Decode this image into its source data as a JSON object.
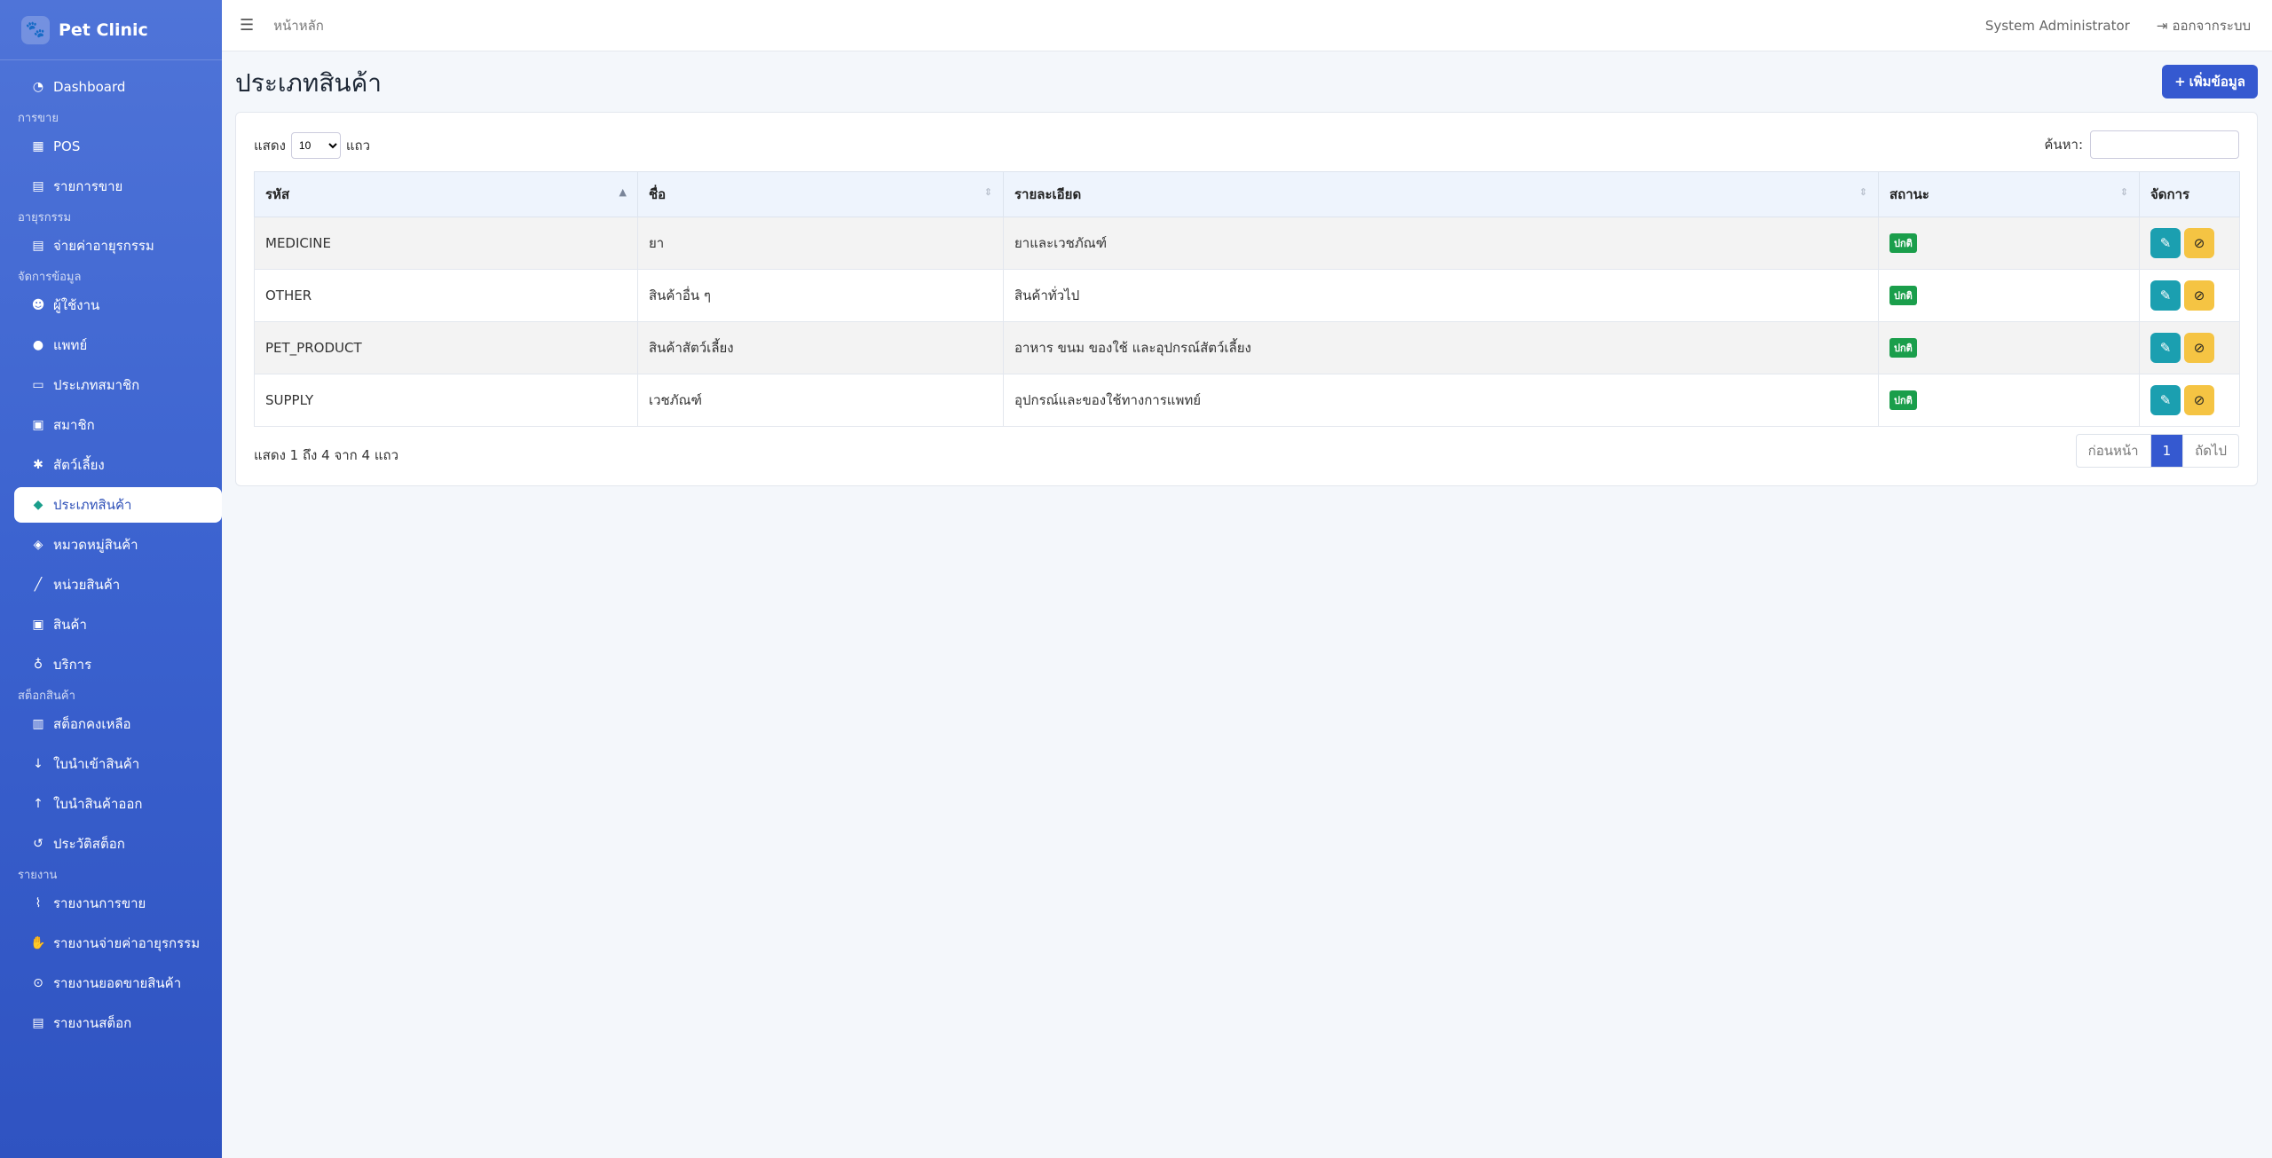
{
  "brand": {
    "name": "Pet Clinic",
    "icon": "paw-icon"
  },
  "sidebar": {
    "dashboard": "Dashboard",
    "sec_sales": "การขาย",
    "pos": "POS",
    "sales_list": "รายการขาย",
    "sec_fee": "อายุรกรรม",
    "pay_fee": "จ่ายค่าอายุรกรรม",
    "sec_data": "จัดการข้อมูล",
    "users": "ผู้ใช้งาน",
    "doctors": "แพทย์",
    "member_types": "ประเภทสมาชิก",
    "members": "สมาชิก",
    "pets": "สัตว์เลี้ยง",
    "product_types": "ประเภทสินค้า",
    "product_categories": "หมวดหมู่สินค้า",
    "product_units": "หน่วยสินค้า",
    "products": "สินค้า",
    "services": "บริการ",
    "sec_stock": "สต็อกสินค้า",
    "stock_left": "สต็อกคงเหลือ",
    "stock_in": "ใบนำเข้าสินค้า",
    "stock_out": "ใบนำสินค้าออก",
    "stock_history": "ประวัติสต็อก",
    "sec_report": "รายงาน",
    "report_sales": "รายงานการขาย",
    "report_fee": "รายงานจ่ายค่าอายุรกรรม",
    "report_top": "รายงานยอดขายสินค้า",
    "report_stock": "รายงานสต็อก"
  },
  "topbar": {
    "home": "หน้าหลัก",
    "user": "System Administrator",
    "logout": "ออกจากระบบ"
  },
  "page": {
    "title": "ประเภทสินค้า",
    "add_label": "เพิ่มข้อมูล"
  },
  "table": {
    "show_label": "แสดง",
    "rows_label": "แถว",
    "page_size": "10",
    "search_label": "ค้นหา:",
    "headers": [
      "รหัส",
      "ชื่อ",
      "รายละเอียด",
      "สถานะ",
      "จัดการ"
    ],
    "rows": [
      {
        "code": "MEDICINE",
        "name": "ยา",
        "detail": "ยาและเวชภัณฑ์",
        "status": "ปกติ"
      },
      {
        "code": "OTHER",
        "name": "สินค้าอื่น ๆ",
        "detail": "สินค้าทั่วไป",
        "status": "ปกติ"
      },
      {
        "code": "PET_PRODUCT",
        "name": "สินค้าสัตว์เลี้ยง",
        "detail": "อาหาร ขนม ของใช้ และอุปกรณ์สัตว์เลี้ยง",
        "status": "ปกติ"
      },
      {
        "code": "SUPPLY",
        "name": "เวชภัณฑ์",
        "detail": "อุปกรณ์และของใช้ทางการแพทย์",
        "status": "ปกติ"
      }
    ],
    "info": "แสดง 1 ถึง 4 จาก 4 แถว",
    "pager": {
      "prev": "ก่อนหน้า",
      "current": "1",
      "next": "ถัดไป"
    }
  },
  "colors": {
    "primary": "#3559d0",
    "success": "#1a9e4b",
    "info": "#1b9fb0",
    "warning": "#f5c443"
  }
}
